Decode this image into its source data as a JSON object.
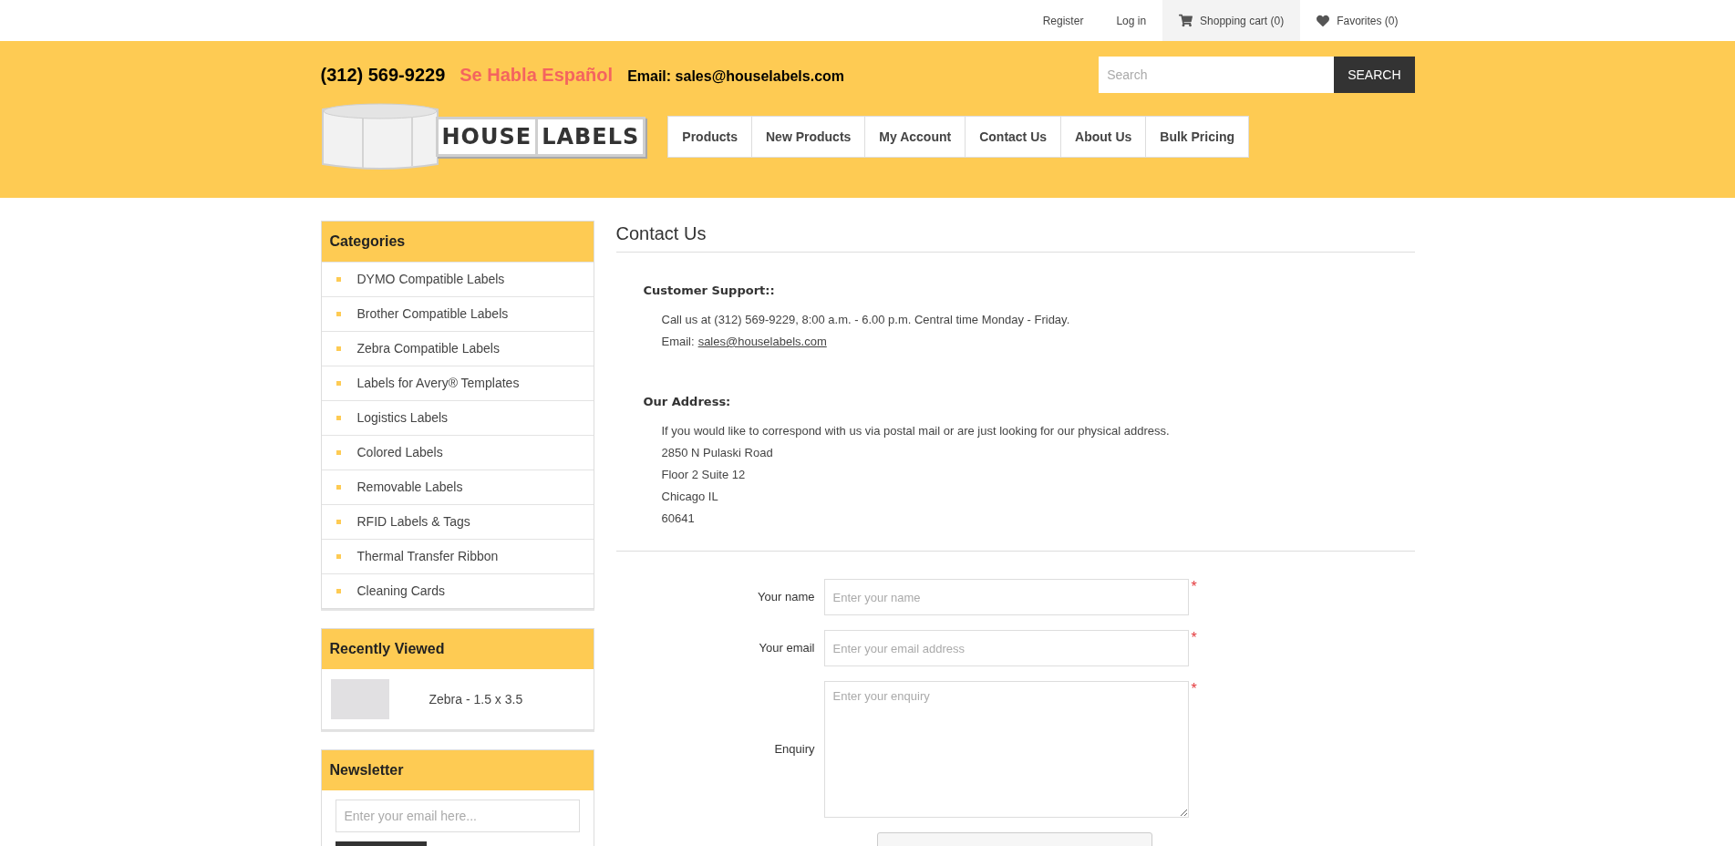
{
  "top_links": [
    {
      "label": "Register",
      "kind": "link"
    },
    {
      "label": "Log in",
      "kind": "link"
    },
    {
      "label": "Shopping cart (0)",
      "kind": "cart"
    },
    {
      "label": "Favorites (0)",
      "kind": "favorites"
    }
  ],
  "header": {
    "phone": "(312) 569-9229",
    "spanish": "Se Habla Español",
    "email": "Email: sales@houselabels.com",
    "logo": [
      "HOUSE",
      "LABELS"
    ],
    "search": {
      "placeholder": "Search",
      "button": "SEARCH"
    }
  },
  "menu": [
    "Products",
    "New Products",
    "My Account",
    "Contact Us",
    "About Us",
    "Bulk Pricing"
  ],
  "sidebar": {
    "categories": {
      "title": "Categories",
      "items": [
        "DYMO Compatible Labels",
        "Brother Compatible Labels",
        "Zebra Compatible Labels",
        "Labels for Avery® Templates",
        "Logistics Labels",
        "Colored Labels",
        "Removable Labels",
        "RFID Labels & Tags",
        "Thermal Transfer Ribbon",
        "Cleaning Cards"
      ]
    },
    "recently_viewed": {
      "title": "Recently Viewed",
      "items": [
        {
          "name": "Zebra - 1.5 x 3.5"
        }
      ]
    },
    "newsletter": {
      "title": "Newsletter",
      "placeholder": "Enter your email here..."
    }
  },
  "content": {
    "title": "Contact Us",
    "sections": [
      {
        "heading": "Customer Support::",
        "lines": [
          {
            "text": "Call us at (312) 569-9229, 8:00 a.m. - 6.00 p.m. Central time Monday - Friday."
          },
          {
            "text": "Email:",
            "link": "sales@houselabels.com"
          }
        ]
      },
      {
        "heading": "Our Address:",
        "lines": [
          {
            "text": "If you would like to correspond with us via postal mail or are just looking for our physical address."
          },
          {
            "text": "2850 N Pulaski Road"
          },
          {
            "text": "Floor 2 Suite 12"
          },
          {
            "text": "Chicago IL"
          },
          {
            "text": "60641"
          }
        ]
      }
    ],
    "form": [
      {
        "label": "Your name",
        "placeholder": "Enter your name",
        "kind": "input",
        "required_mark": "*"
      },
      {
        "label": "Your email",
        "placeholder": "Enter your email address",
        "kind": "input",
        "required_mark": "*"
      },
      {
        "label": "Enquiry",
        "placeholder": "Enter your enquiry",
        "kind": "textarea",
        "required_mark": "*"
      }
    ]
  }
}
